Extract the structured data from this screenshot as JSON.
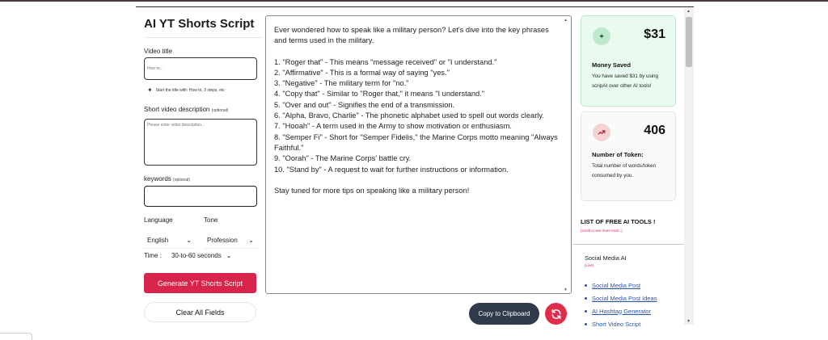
{
  "app": {
    "title": "AI YT Shorts Script"
  },
  "form": {
    "video_title_label": "Video title",
    "video_title_placeholder": "How to...",
    "title_hint": "Start the title with: How to, 3 steps, etc",
    "description_label": "Short video description",
    "description_optional": "(optional)",
    "description_placeholder": "Please enter video description...",
    "keywords_label": "keywords",
    "keywords_optional": "(optional)",
    "language_label": "Language",
    "language_value": "English",
    "tone_label": "Tone",
    "tone_value": "Profession",
    "time_label": "Time :",
    "time_value": "30-to-60 seconds",
    "generate_label": "Generate YT Shorts Script",
    "clear_label": "Clear All Fields"
  },
  "output": {
    "paragraphs": [
      "Ever wondered how to speak like a military person? Let's dive into the key phrases and terms used in the military.",
      "",
      "1. \"Roger that\" - This means \"message received\" or \"I understand.\"",
      "2. \"Affirmative\" - This is a formal way of saying \"yes.\"",
      "3. \"Negative\" - The military term for \"no.\"",
      "4. \"Copy that\" - Similar to \"Roger that,\" it means \"I understand.\"",
      "5. \"Over and out\" - Signifies the end of a transmission.",
      "6. \"Alpha, Bravo, Charlie\" - The phonetic alphabet used to spell out words clearly.",
      "7. \"Hooah\" - A term used in the Army to show motivation or enthusiasm.",
      "8. \"Semper Fi\" - Short for \"Semper Fidelis,\" the Marine Corps motto meaning \"Always Faithful.\"",
      "9. \"Oorah\" - The Marine Corps' battle cry.",
      "10. \"Stand by\" - A request to wait for further instructions or information.",
      "",
      "Stay tuned for more tips on speaking like a military person!"
    ],
    "copy_label": "Copy to Clipboard"
  },
  "sidebar": {
    "money": {
      "value": "$31",
      "title": "Money Saved",
      "desc": "You have saved $31 by using scripAI over other AI tools!"
    },
    "tokens": {
      "value": "406",
      "title": "Number of Token:",
      "desc": "Total number of words/token consumed by you."
    },
    "free_tools_title": "LIST OF FREE AI TOOLS !",
    "free_tools_sub": "(scroll to see more tools ;)",
    "category": {
      "title": "Social Media AI",
      "sub": "(Live)"
    },
    "tools": [
      "Social Media Post",
      "Social Media Post Ideas",
      "AI Hashtag Generator",
      "Short Video Script"
    ]
  },
  "colors": {
    "accent": "#d8234a",
    "dark_button": "#2f3b4a",
    "money_card": "#e9fbef",
    "link": "#2556a8"
  },
  "icons": {
    "hint": "sparkle-icon",
    "money": "sparkle-icon",
    "tokens": "trend-up-icon",
    "refresh": "refresh-icon"
  }
}
